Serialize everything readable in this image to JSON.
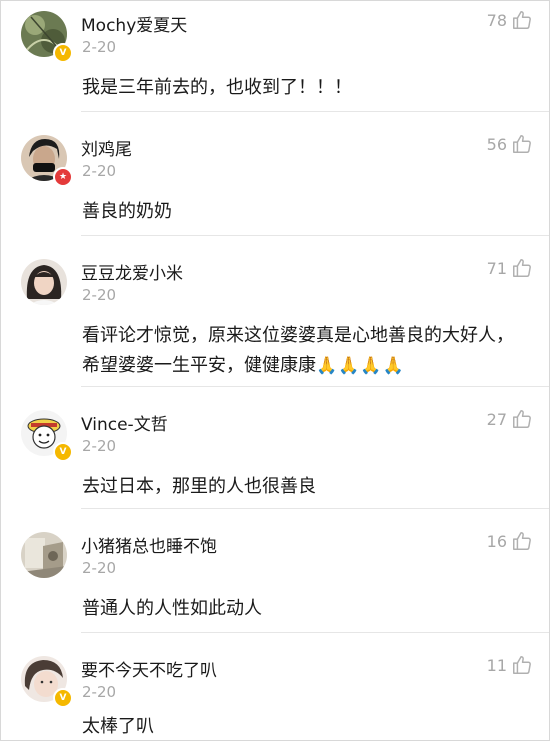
{
  "comments": [
    {
      "username": "Mochy爱夏天",
      "date": "2-20",
      "likes": "78",
      "content": "我是三年前去的，也收到了！！！",
      "badge": "V"
    },
    {
      "username": "刘鸡尾",
      "date": "2-20",
      "likes": "56",
      "content": "善良的奶奶",
      "badge": "★"
    },
    {
      "username": "豆豆龙爱小米",
      "date": "2-20",
      "likes": "71",
      "content": "看评论才惊觉，原来这位婆婆真是心地善良的大好人，希望婆婆一生平安，健健康康",
      "emoji": "🙏🙏🙏🙏"
    },
    {
      "username": "Vince-文哲",
      "date": "2-20",
      "likes": "27",
      "content": "去过日本，那里的人也很善良",
      "badge": "V"
    },
    {
      "username": "小猪猪总也睡不饱",
      "date": "2-20",
      "likes": "16",
      "content": "普通人的人性如此动人"
    },
    {
      "username": "要不今天不吃了叭",
      "date": "2-20",
      "likes": "11",
      "content": "太棒了叭",
      "badge": "V"
    }
  ],
  "colors": {
    "meta_gray": "#a7a7a7",
    "badge_gold": "#f5b800",
    "badge_red": "#e43a3a"
  },
  "icons": {
    "like": "thumbs-up-icon"
  }
}
